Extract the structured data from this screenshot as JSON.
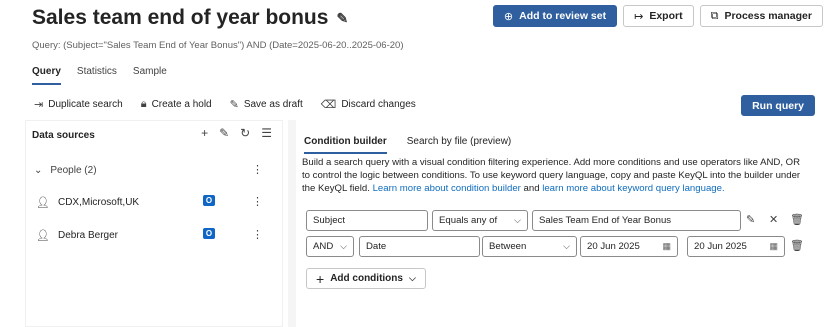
{
  "header": {
    "title": "Sales team end of year bonus",
    "add_review_label": "Add to review set",
    "export_label": "Export",
    "process_label": "Process manager"
  },
  "query_text": "Query: (Subject=\"Sales Team End of Year Bonus\") AND (Date=2025-06-20..2025-06-20)",
  "tabs": [
    "Query",
    "Statistics",
    "Sample"
  ],
  "toolbar": {
    "duplicate": "Duplicate search",
    "hold": "Create a hold",
    "draft": "Save as draft",
    "discard": "Discard changes",
    "run": "Run query"
  },
  "sources": {
    "heading": "Data sources",
    "group": "People (2)",
    "items": [
      "CDX,Microsoft,UK",
      "Debra Berger"
    ]
  },
  "builder": {
    "tab_active": "Condition builder",
    "tab_other": "Search by file (preview)",
    "desc_text": "Build a search query with a visual condition filtering experience. Add more conditions and use operators like AND, OR to control the logic between conditions. To use keyword query language, copy and paste KeyQL into the builder under the KeyQL field.",
    "link1": "Learn more about condition builder",
    "and_word": "and",
    "link2": "learn more about keyword query language.",
    "row1": {
      "field": "Subject",
      "operator": "Equals any of",
      "value": "Sales Team End of Year Bonus"
    },
    "row2": {
      "logic": "AND",
      "field": "Date",
      "operator": "Between",
      "from": "20 Jun 2025",
      "to": "20 Jun 2025"
    },
    "add_label": "Add conditions"
  },
  "colors": {
    "accent": "#2f5f9e",
    "link": "#0f6cbd",
    "outlook": "#1066c5"
  }
}
